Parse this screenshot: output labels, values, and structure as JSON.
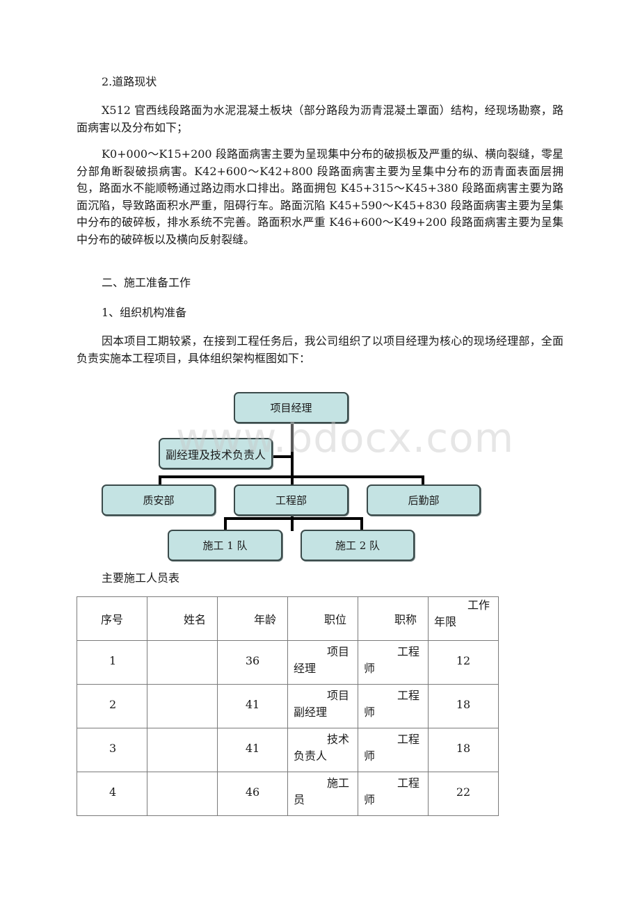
{
  "section_heading": "2.道路现状",
  "paragraphs": {
    "p1": "X512 官西线段路面为水泥混凝土板块（部分路段为沥青混凝土罩面）结构，经现场勘察，路面病害以及分布如下；",
    "p2": "K0+000～K15+200 段路面病害主要为呈现集中分布的破损板及严重的纵、横向裂缝，零星分部角断裂破损病害。K42+600～K42+800 段路面病害主要为呈集中分布的沥青面表面层拥包，路面水不能顺畅通过路边雨水口排出。路面拥包 K45+315～K45+380 段路面病害主要为路面沉陷，导致路面积水严重，阻碍行车。路面沉陷 K45+590～K45+830 段路面病害主要为呈集中分布的破碎板，排水系统不完善。路面积水严重 K46+600～K49+200 段路面病害主要为呈集中分布的破碎板以及横向反射裂缝。",
    "p3": "因本项目工期较紧，在接到工程任务后，我公司组织了以项目经理为核心的现场经理部，全面负责实施本工程项目，具体组织架构框图如下："
  },
  "heading2": "二、施工准备工作",
  "heading3": "1、组织机构准备",
  "org_chart": {
    "top": "项目经理",
    "deputy": "副经理及技术负责人",
    "departments": [
      "质安部",
      "工程部",
      "后勤部"
    ],
    "teams": [
      "施工 1 队",
      "施工 2 队"
    ]
  },
  "watermark": "www.bdocx.com",
  "table_title": "主要施工人员表",
  "table": {
    "headers": [
      "序号",
      "姓名",
      "年龄",
      "职位",
      "职称",
      "工作年限"
    ],
    "header_wrap": {
      "line1": "工作",
      "line2": "年限"
    },
    "rows": [
      {
        "no": "1",
        "name": "",
        "age": "36",
        "pos1": "项目",
        "pos2": "经理",
        "title1": "工程",
        "title2": "师",
        "years": "12"
      },
      {
        "no": "2",
        "name": "",
        "age": "41",
        "pos1": "项目",
        "pos2": "副经理",
        "title1": "工程",
        "title2": "师",
        "years": "18"
      },
      {
        "no": "3",
        "name": "",
        "age": "41",
        "pos1": "技术",
        "pos2": "负责人",
        "title1": "工程",
        "title2": "师",
        "years": "18"
      },
      {
        "no": "4",
        "name": "",
        "age": "46",
        "pos1": "施工",
        "pos2": "员",
        "title1": "工程",
        "title2": "师",
        "years": "22"
      }
    ]
  }
}
